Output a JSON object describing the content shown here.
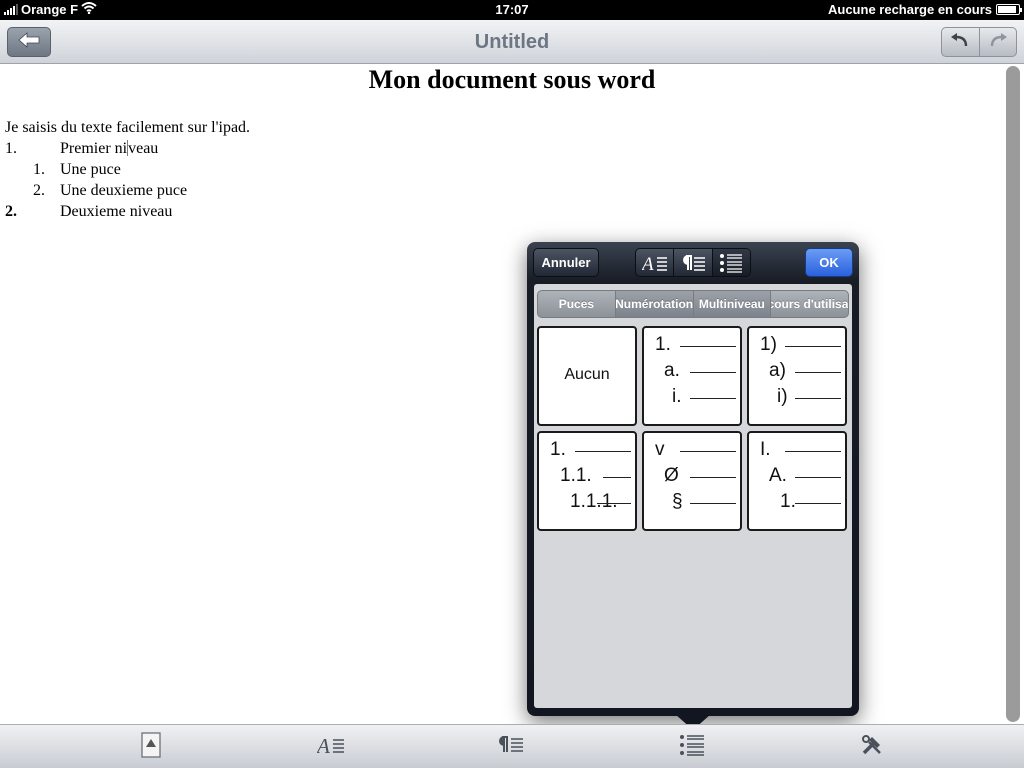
{
  "status_bar": {
    "carrier": "Orange F",
    "time": "17:07",
    "battery_status": "Aucune recharge en cours",
    "battery_level": 0.9
  },
  "nav": {
    "title": "Untitled",
    "back_icon": "back-arrow-icon",
    "undo_icon": "undo-icon",
    "redo_icon": "redo-icon"
  },
  "document": {
    "heading": "Mon document  sous word",
    "paragraph": "Je saisis du texte facilement sur l'ipad.",
    "list": [
      {
        "number": "1.",
        "text_before_cursor": "Premier ni",
        "text_after_cursor": "veau"
      },
      {
        "number": "1.",
        "text": "Une puce"
      },
      {
        "number": "2.",
        "text": "Une deuxieme puce"
      },
      {
        "number": "2.",
        "text": "Deuxieme niveau"
      }
    ]
  },
  "popover": {
    "cancel_label": "Annuler",
    "ok_label": "OK",
    "format_tabs": [
      "character-format-icon",
      "paragraph-format-icon",
      "list-format-icon"
    ],
    "list_tabs": [
      "Puces",
      "Numérotation",
      "Multiniveau",
      "En cours d'utilisation"
    ],
    "styles": [
      {
        "kind": "none",
        "label": "Aucun"
      },
      {
        "kind": "levels",
        "levels": [
          "1.",
          "a.",
          "i."
        ]
      },
      {
        "kind": "levels",
        "levels": [
          "1)",
          "a)",
          "i)"
        ]
      },
      {
        "kind": "levels",
        "levels": [
          "1.",
          "1.1.",
          "1.1.1."
        ]
      },
      {
        "kind": "levels",
        "levels": [
          "v",
          "Ø",
          "§"
        ]
      },
      {
        "kind": "levels",
        "levels": [
          "I.",
          "A.",
          "1."
        ]
      }
    ]
  },
  "toolbar": {
    "items": [
      "document-icon",
      "character-format-icon",
      "paragraph-format-icon",
      "list-format-icon",
      "tools-icon"
    ]
  }
}
